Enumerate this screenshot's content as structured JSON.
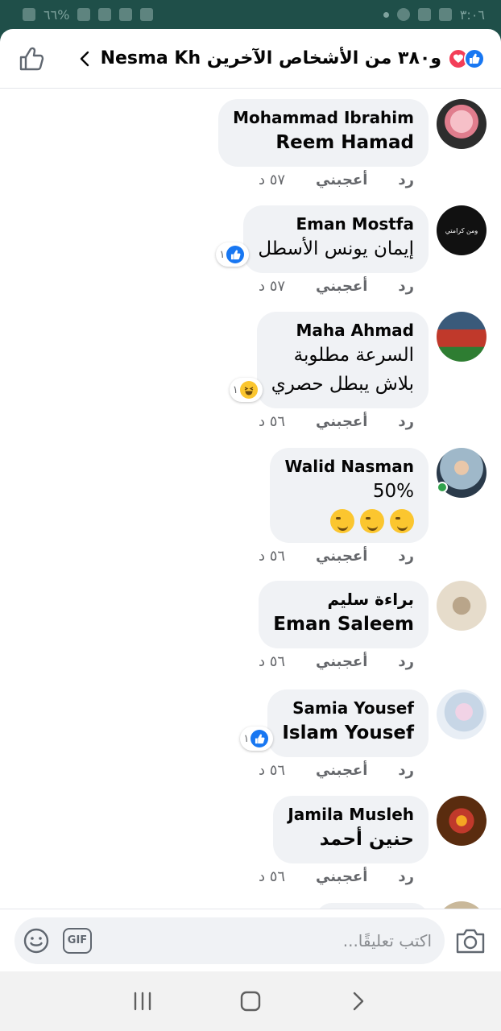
{
  "status_bar": {
    "battery_text": "٦٦%",
    "time": "٣:٠٦"
  },
  "header": {
    "title": "و٣٨٠ من الأشخاص الآخرين Nesma Kh"
  },
  "comments": [
    {
      "author": "Mohammad Ibrahim",
      "lines": [
        "Reem Hamad"
      ],
      "bold_text": true,
      "time": "٥٧ د",
      "like_label": "أعجبني",
      "reply_label": "رد",
      "avatar_color": "#e8a7b0"
    },
    {
      "author": "Eman Mostfa",
      "lines": [
        "إيمان يونس الأسطل"
      ],
      "bold_text": false,
      "time": "٥٧ د",
      "like_label": "أعجبني",
      "reply_label": "رد",
      "reaction": {
        "icon": "like-icon",
        "count": "١"
      },
      "avatar_color": "#111111",
      "avatar_caption": "ومن كرامتي"
    },
    {
      "author": "Maha Ahmad",
      "lines": [
        "السرعة مطلوبة",
        "بلاش يبطل حصري"
      ],
      "bold_text": false,
      "time": "٥٦ د",
      "like_label": "أعجبني",
      "reply_label": "رد",
      "reaction": {
        "icon": "haha-icon",
        "count": "١"
      },
      "avatar_color": "#c0392b"
    },
    {
      "author": "Walid Nasman",
      "lines": [
        "50%"
      ],
      "bold_text": false,
      "emojis": [
        "wink-icon",
        "wink-icon",
        "wink-icon"
      ],
      "time": "٥٦ د",
      "like_label": "أعجبني",
      "reply_label": "رد",
      "online": true,
      "avatar_color": "#9fb8c9"
    },
    {
      "author": "براءة سليم",
      "lines": [
        "Eman Saleem"
      ],
      "bold_text": true,
      "time": "٥٦ د",
      "like_label": "أعجبني",
      "reply_label": "رد",
      "avatar_color": "#d8c6a8"
    },
    {
      "author": "Samia Yousef",
      "lines": [
        "Islam Yousef"
      ],
      "bold_text": true,
      "time": "٥٦ د",
      "like_label": "أعجبني",
      "reply_label": "رد",
      "reaction": {
        "icon": "like-icon",
        "count": "١"
      },
      "avatar_color": "#c7d6e6"
    },
    {
      "author": "Jamila Musleh",
      "lines": [
        "حنين أحمد"
      ],
      "bold_text": true,
      "time": "٥٦ د",
      "like_label": "أعجبني",
      "reply_label": "رد",
      "avatar_color": "#8a4a1c"
    }
  ],
  "composer": {
    "placeholder": "اكتب تعليقًا...",
    "gif_label": "GIF"
  },
  "colors": {
    "accent": "#1877f2",
    "bubble": "#f0f2f5",
    "meta": "#65676b",
    "online": "#31a24c",
    "love": "#f33e58",
    "haha": "#fbc62f"
  }
}
